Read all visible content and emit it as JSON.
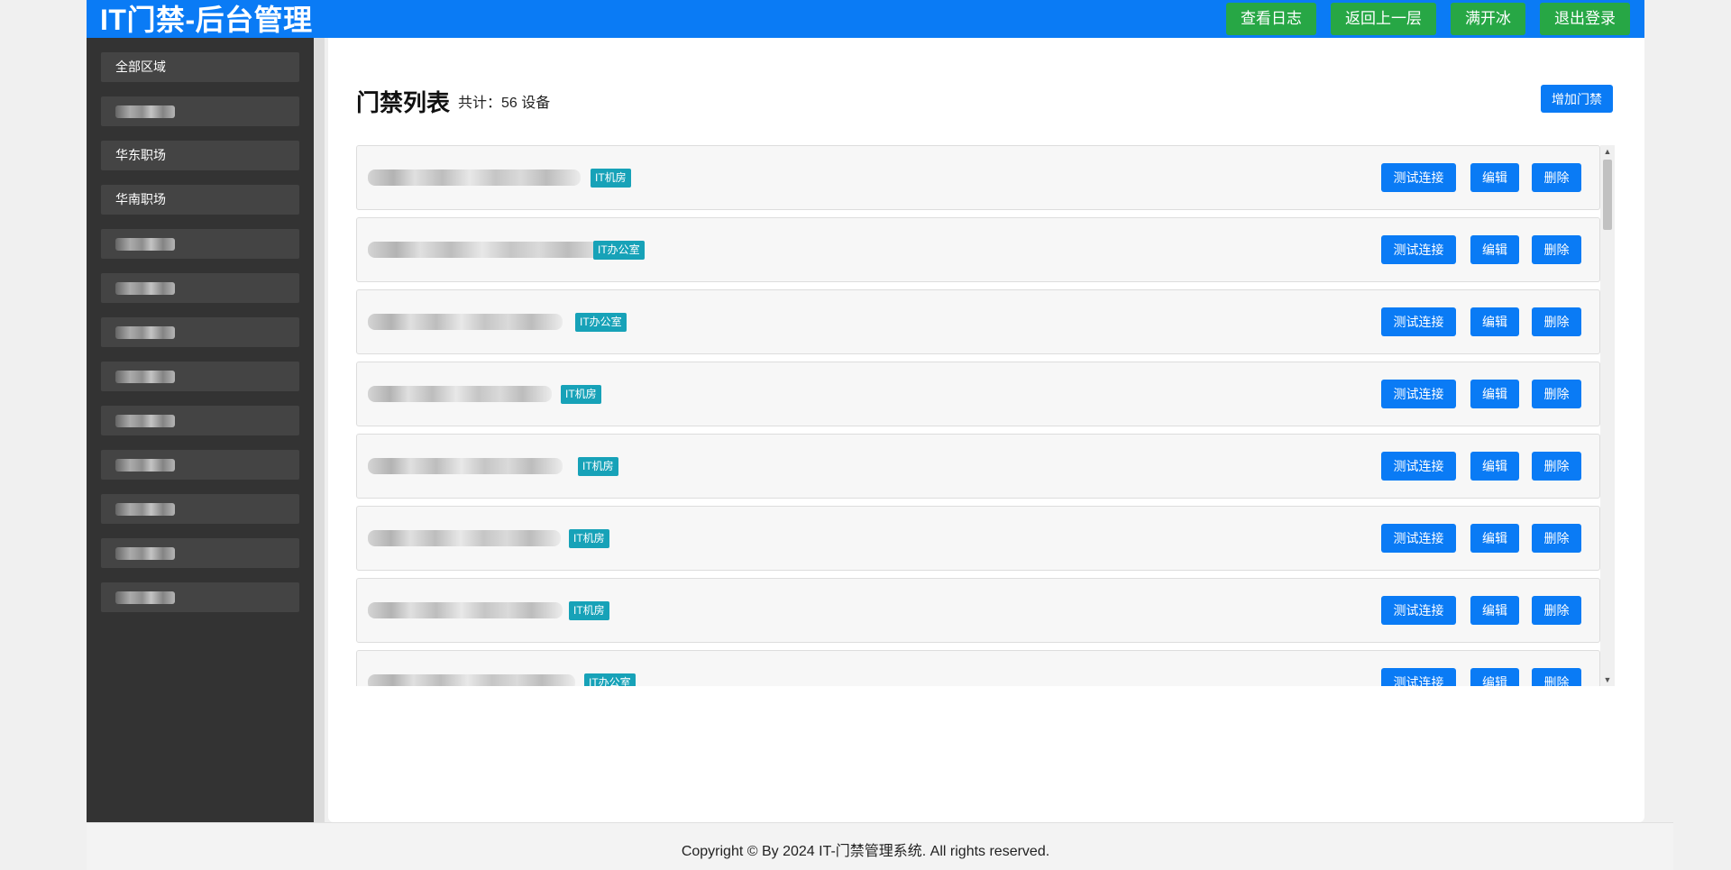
{
  "header": {
    "title": "IT门禁-后台管理",
    "buttons": [
      "查看日志",
      "返回上一层",
      "满开冰",
      "退出登录"
    ]
  },
  "sidebar": {
    "items": [
      {
        "label": "全部区域",
        "blurred": false
      },
      {
        "label": "",
        "blurred": true
      },
      {
        "label": "华东职场",
        "blurred": false
      },
      {
        "label": "华南职场",
        "blurred": false
      },
      {
        "label": "",
        "blurred": true
      },
      {
        "label": "",
        "blurred": true
      },
      {
        "label": "",
        "blurred": true
      },
      {
        "label": "",
        "blurred": true
      },
      {
        "label": "",
        "blurred": true
      },
      {
        "label": "",
        "blurred": true
      },
      {
        "label": "",
        "blurred": true
      },
      {
        "label": "",
        "blurred": true
      },
      {
        "label": "",
        "blurred": true
      }
    ]
  },
  "main": {
    "title": "门禁列表",
    "count": "共计：56 设备",
    "add_button": "增加门禁",
    "devices": [
      {
        "tag": "IT机房"
      },
      {
        "tag": "IT办公室"
      },
      {
        "tag": "IT办公室"
      },
      {
        "tag": "IT机房"
      },
      {
        "tag": "IT机房"
      },
      {
        "tag": "IT机房"
      },
      {
        "tag": "IT机房"
      },
      {
        "tag": "IT办公室"
      }
    ],
    "row_buttons": {
      "test": "测试连接",
      "edit": "编辑",
      "delete": "删除"
    }
  },
  "footer": {
    "copyright": "Copyright © By 2024 IT-门禁管理系统. All rights reserved."
  },
  "colors": {
    "primary": "#0a7bf5",
    "success": "#27a745",
    "tag": "#17a2b8",
    "sidebar": "#333333"
  }
}
